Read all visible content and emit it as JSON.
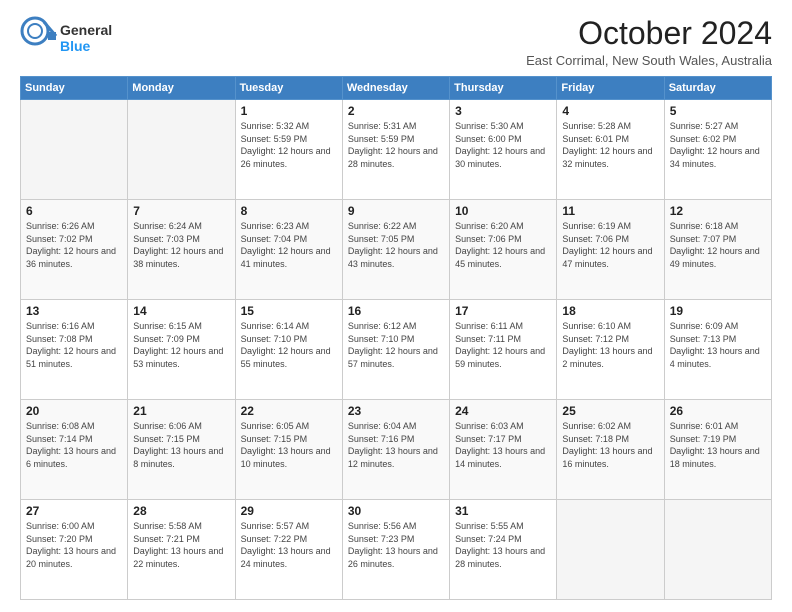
{
  "logo": {
    "text_general": "General",
    "text_blue": "Blue"
  },
  "header": {
    "month": "October 2024",
    "location": "East Corrimal, New South Wales, Australia"
  },
  "weekdays": [
    "Sunday",
    "Monday",
    "Tuesday",
    "Wednesday",
    "Thursday",
    "Friday",
    "Saturday"
  ],
  "weeks": [
    [
      {
        "day": "",
        "sunrise": "",
        "sunset": "",
        "daylight": "",
        "empty": true
      },
      {
        "day": "",
        "sunrise": "",
        "sunset": "",
        "daylight": "",
        "empty": true
      },
      {
        "day": "1",
        "sunrise": "Sunrise: 5:32 AM",
        "sunset": "Sunset: 5:59 PM",
        "daylight": "Daylight: 12 hours and 26 minutes.",
        "empty": false
      },
      {
        "day": "2",
        "sunrise": "Sunrise: 5:31 AM",
        "sunset": "Sunset: 5:59 PM",
        "daylight": "Daylight: 12 hours and 28 minutes.",
        "empty": false
      },
      {
        "day": "3",
        "sunrise": "Sunrise: 5:30 AM",
        "sunset": "Sunset: 6:00 PM",
        "daylight": "Daylight: 12 hours and 30 minutes.",
        "empty": false
      },
      {
        "day": "4",
        "sunrise": "Sunrise: 5:28 AM",
        "sunset": "Sunset: 6:01 PM",
        "daylight": "Daylight: 12 hours and 32 minutes.",
        "empty": false
      },
      {
        "day": "5",
        "sunrise": "Sunrise: 5:27 AM",
        "sunset": "Sunset: 6:02 PM",
        "daylight": "Daylight: 12 hours and 34 minutes.",
        "empty": false
      }
    ],
    [
      {
        "day": "6",
        "sunrise": "Sunrise: 6:26 AM",
        "sunset": "Sunset: 7:02 PM",
        "daylight": "Daylight: 12 hours and 36 minutes.",
        "empty": false
      },
      {
        "day": "7",
        "sunrise": "Sunrise: 6:24 AM",
        "sunset": "Sunset: 7:03 PM",
        "daylight": "Daylight: 12 hours and 38 minutes.",
        "empty": false
      },
      {
        "day": "8",
        "sunrise": "Sunrise: 6:23 AM",
        "sunset": "Sunset: 7:04 PM",
        "daylight": "Daylight: 12 hours and 41 minutes.",
        "empty": false
      },
      {
        "day": "9",
        "sunrise": "Sunrise: 6:22 AM",
        "sunset": "Sunset: 7:05 PM",
        "daylight": "Daylight: 12 hours and 43 minutes.",
        "empty": false
      },
      {
        "day": "10",
        "sunrise": "Sunrise: 6:20 AM",
        "sunset": "Sunset: 7:06 PM",
        "daylight": "Daylight: 12 hours and 45 minutes.",
        "empty": false
      },
      {
        "day": "11",
        "sunrise": "Sunrise: 6:19 AM",
        "sunset": "Sunset: 7:06 PM",
        "daylight": "Daylight: 12 hours and 47 minutes.",
        "empty": false
      },
      {
        "day": "12",
        "sunrise": "Sunrise: 6:18 AM",
        "sunset": "Sunset: 7:07 PM",
        "daylight": "Daylight: 12 hours and 49 minutes.",
        "empty": false
      }
    ],
    [
      {
        "day": "13",
        "sunrise": "Sunrise: 6:16 AM",
        "sunset": "Sunset: 7:08 PM",
        "daylight": "Daylight: 12 hours and 51 minutes.",
        "empty": false
      },
      {
        "day": "14",
        "sunrise": "Sunrise: 6:15 AM",
        "sunset": "Sunset: 7:09 PM",
        "daylight": "Daylight: 12 hours and 53 minutes.",
        "empty": false
      },
      {
        "day": "15",
        "sunrise": "Sunrise: 6:14 AM",
        "sunset": "Sunset: 7:10 PM",
        "daylight": "Daylight: 12 hours and 55 minutes.",
        "empty": false
      },
      {
        "day": "16",
        "sunrise": "Sunrise: 6:12 AM",
        "sunset": "Sunset: 7:10 PM",
        "daylight": "Daylight: 12 hours and 57 minutes.",
        "empty": false
      },
      {
        "day": "17",
        "sunrise": "Sunrise: 6:11 AM",
        "sunset": "Sunset: 7:11 PM",
        "daylight": "Daylight: 12 hours and 59 minutes.",
        "empty": false
      },
      {
        "day": "18",
        "sunrise": "Sunrise: 6:10 AM",
        "sunset": "Sunset: 7:12 PM",
        "daylight": "Daylight: 13 hours and 2 minutes.",
        "empty": false
      },
      {
        "day": "19",
        "sunrise": "Sunrise: 6:09 AM",
        "sunset": "Sunset: 7:13 PM",
        "daylight": "Daylight: 13 hours and 4 minutes.",
        "empty": false
      }
    ],
    [
      {
        "day": "20",
        "sunrise": "Sunrise: 6:08 AM",
        "sunset": "Sunset: 7:14 PM",
        "daylight": "Daylight: 13 hours and 6 minutes.",
        "empty": false
      },
      {
        "day": "21",
        "sunrise": "Sunrise: 6:06 AM",
        "sunset": "Sunset: 7:15 PM",
        "daylight": "Daylight: 13 hours and 8 minutes.",
        "empty": false
      },
      {
        "day": "22",
        "sunrise": "Sunrise: 6:05 AM",
        "sunset": "Sunset: 7:15 PM",
        "daylight": "Daylight: 13 hours and 10 minutes.",
        "empty": false
      },
      {
        "day": "23",
        "sunrise": "Sunrise: 6:04 AM",
        "sunset": "Sunset: 7:16 PM",
        "daylight": "Daylight: 13 hours and 12 minutes.",
        "empty": false
      },
      {
        "day": "24",
        "sunrise": "Sunrise: 6:03 AM",
        "sunset": "Sunset: 7:17 PM",
        "daylight": "Daylight: 13 hours and 14 minutes.",
        "empty": false
      },
      {
        "day": "25",
        "sunrise": "Sunrise: 6:02 AM",
        "sunset": "Sunset: 7:18 PM",
        "daylight": "Daylight: 13 hours and 16 minutes.",
        "empty": false
      },
      {
        "day": "26",
        "sunrise": "Sunrise: 6:01 AM",
        "sunset": "Sunset: 7:19 PM",
        "daylight": "Daylight: 13 hours and 18 minutes.",
        "empty": false
      }
    ],
    [
      {
        "day": "27",
        "sunrise": "Sunrise: 6:00 AM",
        "sunset": "Sunset: 7:20 PM",
        "daylight": "Daylight: 13 hours and 20 minutes.",
        "empty": false
      },
      {
        "day": "28",
        "sunrise": "Sunrise: 5:58 AM",
        "sunset": "Sunset: 7:21 PM",
        "daylight": "Daylight: 13 hours and 22 minutes.",
        "empty": false
      },
      {
        "day": "29",
        "sunrise": "Sunrise: 5:57 AM",
        "sunset": "Sunset: 7:22 PM",
        "daylight": "Daylight: 13 hours and 24 minutes.",
        "empty": false
      },
      {
        "day": "30",
        "sunrise": "Sunrise: 5:56 AM",
        "sunset": "Sunset: 7:23 PM",
        "daylight": "Daylight: 13 hours and 26 minutes.",
        "empty": false
      },
      {
        "day": "31",
        "sunrise": "Sunrise: 5:55 AM",
        "sunset": "Sunset: 7:24 PM",
        "daylight": "Daylight: 13 hours and 28 minutes.",
        "empty": false
      },
      {
        "day": "",
        "sunrise": "",
        "sunset": "",
        "daylight": "",
        "empty": true
      },
      {
        "day": "",
        "sunrise": "",
        "sunset": "",
        "daylight": "",
        "empty": true
      }
    ]
  ]
}
